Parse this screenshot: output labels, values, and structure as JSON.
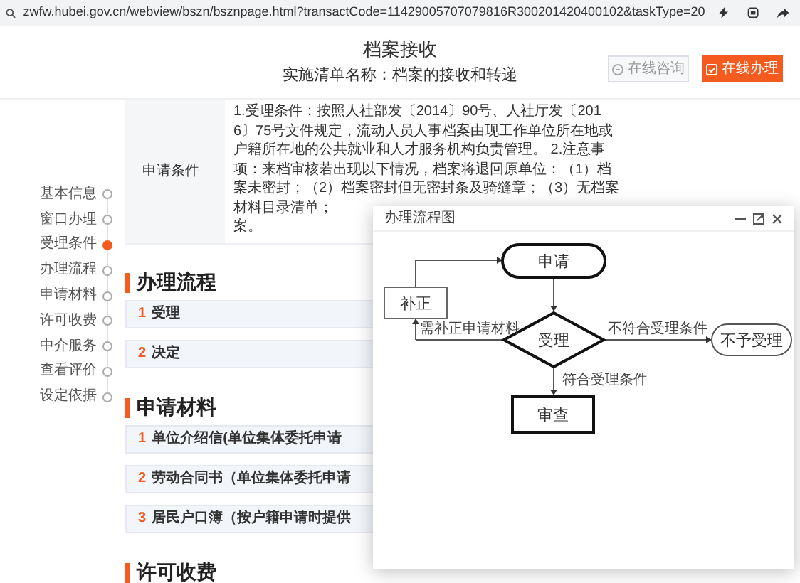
{
  "address_bar": {
    "url": "zwfw.hubei.gov.cn/webview/bszn/bsznpage.html?transactCode=11429005707079816R300201420400102&taskType=20"
  },
  "header": {
    "title": "档案接收",
    "subtitle": "实施清单名称：档案的接收和转递",
    "buttons": [
      {
        "label": "在线咨询",
        "kind": "outline"
      },
      {
        "label": "在线办理",
        "kind": "primary"
      }
    ]
  },
  "side_nav": [
    {
      "label": "基本信息",
      "selected": false
    },
    {
      "label": "窗口办理",
      "selected": false
    },
    {
      "label": "受理条件",
      "selected": true
    },
    {
      "label": "办理流程",
      "selected": false
    },
    {
      "label": "申请材料",
      "selected": false
    },
    {
      "label": "许可收费",
      "selected": false
    },
    {
      "label": "中介服务",
      "selected": false
    },
    {
      "label": "查看评价",
      "selected": false
    },
    {
      "label": "设定依据",
      "selected": false
    }
  ],
  "conditions": {
    "label": "申请条件",
    "lines": [
      "1.受理条件：按照人社部发〔2014〕90号、人社厅发〔201",
      "6〕75号文件规定，流动人员人事档案由现工作单位所在地或",
      "户籍所在地的公共就业和人才服务机构负责管理。 2.注意事",
      "项：来档审核若出现以下情况，档案将退回原单位：（1）档",
      "案未密封；（2）档案密封但无密封条及骑缝章；（3）无档案",
      "材料目录清单；",
      "案。"
    ]
  },
  "sections": [
    {
      "title": "办理流程",
      "items": [
        {
          "number": "1",
          "label": "受理"
        },
        {
          "number": "2",
          "label": "决定"
        }
      ]
    },
    {
      "title": "申请材料",
      "items": [
        {
          "number": "1",
          "label": "单位介绍信(单位集体委托申请"
        },
        {
          "number": "2",
          "label": "劳动合同书（单位集体委托申请"
        },
        {
          "number": "3",
          "label": "居民户口簿（按户籍申请时提供"
        }
      ]
    },
    {
      "title": "许可收费"
    }
  ],
  "dialog": {
    "title": "办理流程图",
    "flowchart": {
      "nodes": [
        {
          "label": "申请",
          "kind": "terminal"
        },
        {
          "label": "补正",
          "kind": "process"
        },
        {
          "label": "受理",
          "kind": "decision"
        },
        {
          "label": "不予受理",
          "kind": "end"
        },
        {
          "label": "审查",
          "kind": "process_bold"
        }
      ],
      "edges": [
        {
          "label": "需补正申请材料"
        },
        {
          "label": "不符合受理条件"
        },
        {
          "label": "符合受理条件"
        }
      ]
    }
  }
}
